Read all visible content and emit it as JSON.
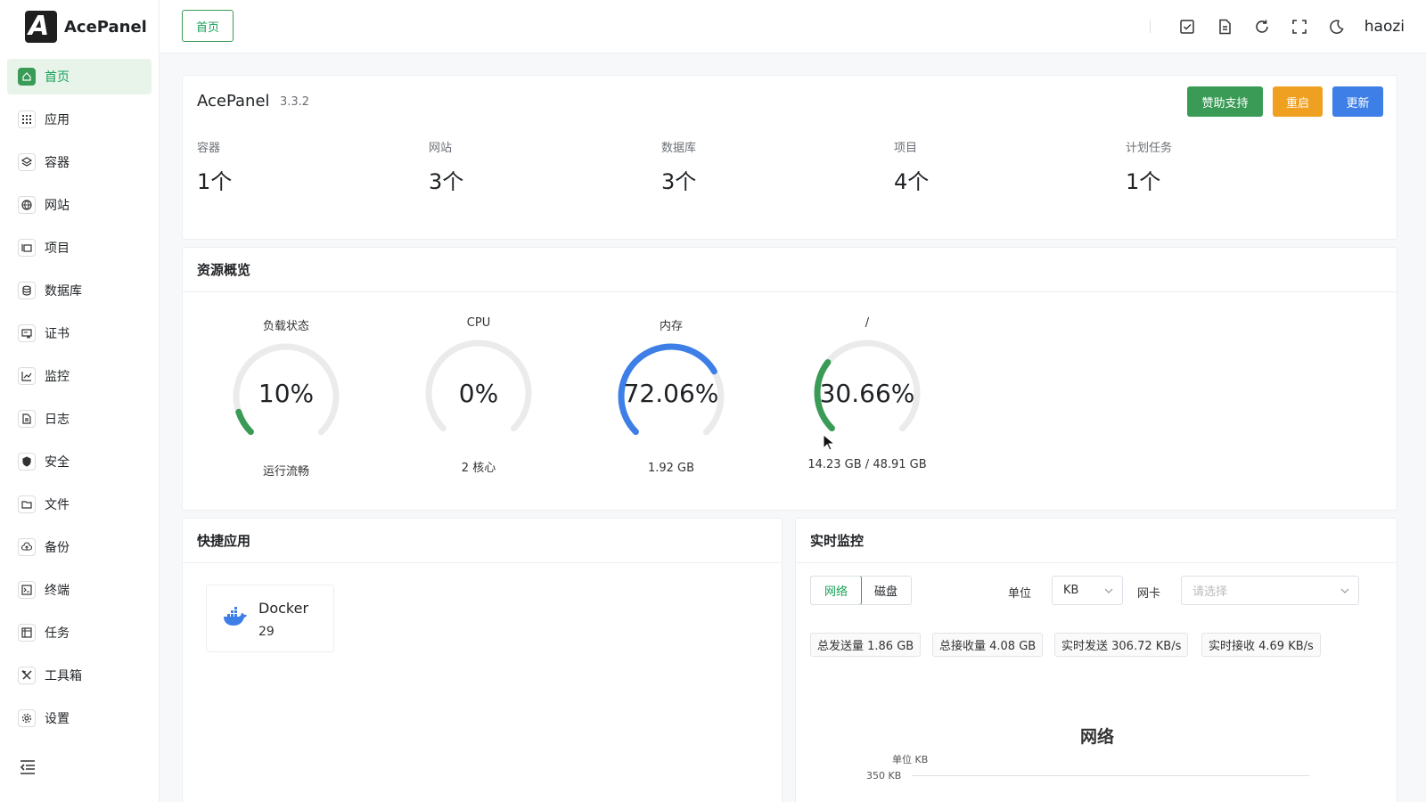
{
  "brand": {
    "name": "AcePanel",
    "mark": "A"
  },
  "sidebar": {
    "items": [
      {
        "label": "首页",
        "icon": "home-icon"
      },
      {
        "label": "应用",
        "icon": "apps-icon"
      },
      {
        "label": "容器",
        "icon": "layers-icon"
      },
      {
        "label": "网站",
        "icon": "globe-icon"
      },
      {
        "label": "项目",
        "icon": "folder-stack-icon"
      },
      {
        "label": "数据库",
        "icon": "database-icon"
      },
      {
        "label": "证书",
        "icon": "certificate-icon"
      },
      {
        "label": "监控",
        "icon": "chart-line-icon"
      },
      {
        "label": "日志",
        "icon": "file-text-icon"
      },
      {
        "label": "安全",
        "icon": "shield-icon"
      },
      {
        "label": "文件",
        "icon": "folder-open-icon"
      },
      {
        "label": "备份",
        "icon": "cloud-icon"
      },
      {
        "label": "终端",
        "icon": "terminal-icon"
      },
      {
        "label": "任务",
        "icon": "task-icon"
      },
      {
        "label": "工具箱",
        "icon": "tools-icon"
      },
      {
        "label": "设置",
        "icon": "gear-icon"
      }
    ]
  },
  "header": {
    "tab": "首页",
    "user": "haozi"
  },
  "overview": {
    "title": "AcePanel",
    "version": "3.3.2",
    "buttons": {
      "sponsor": "赞助支持",
      "restart": "重启",
      "update": "更新"
    },
    "stats": [
      {
        "label": "容器",
        "value": "1个"
      },
      {
        "label": "网站",
        "value": "3个"
      },
      {
        "label": "数据库",
        "value": "3个"
      },
      {
        "label": "项目",
        "value": "4个"
      },
      {
        "label": "计划任务",
        "value": "1个"
      }
    ]
  },
  "resources": {
    "title": "资源概览",
    "gauges": [
      {
        "title": "负载状态",
        "value": "10%",
        "percent": 10,
        "sub": "运行流畅",
        "color": "#3a9b56"
      },
      {
        "title": "CPU",
        "value": "0%",
        "percent": 0,
        "sub": "2 核心",
        "color": "#3a9b56"
      },
      {
        "title": "内存",
        "value": "72.06%",
        "percent": 72.06,
        "sub": "1.92 GB",
        "color": "#3d7fe6"
      },
      {
        "title": "/",
        "value": "30.66%",
        "percent": 30.66,
        "sub": "14.23 GB / 48.91 GB",
        "color": "#3a9b56"
      }
    ]
  },
  "quick_apps": {
    "title": "快捷应用",
    "items": [
      {
        "name": "Docker",
        "count": "29"
      }
    ]
  },
  "monitor": {
    "title": "实时监控",
    "tabs": [
      "网络",
      "磁盘"
    ],
    "unit_label": "单位",
    "unit_value": "KB",
    "nic_label": "网卡",
    "nic_placeholder": "请选择",
    "tags": [
      "总发送量 1.86 GB",
      "总接收量 4.08 GB",
      "实时发送 306.72 KB/s",
      "实时接收 4.69 KB/s"
    ],
    "chart_title": "网络",
    "chart_unit": "单位 KB",
    "chart_tick": "350 KB"
  }
}
